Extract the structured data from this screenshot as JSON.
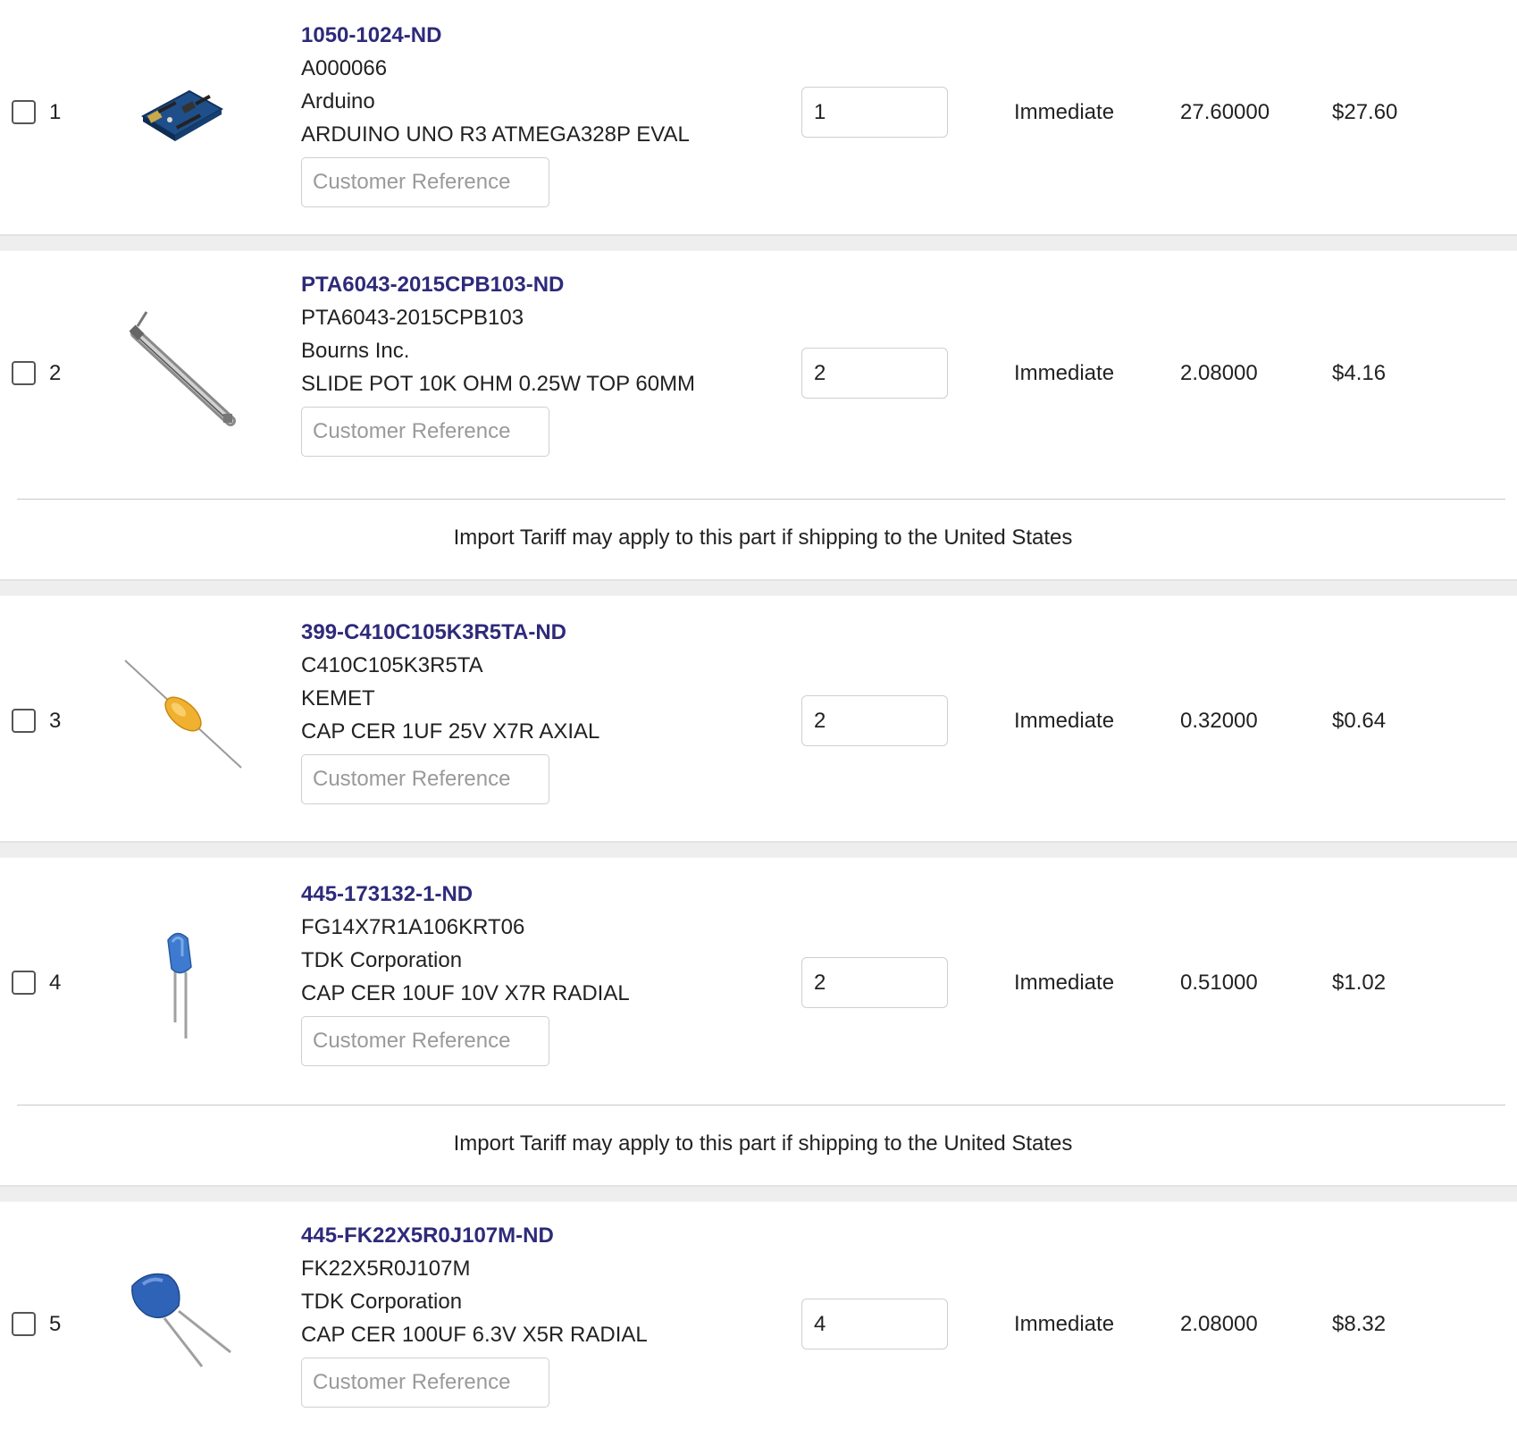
{
  "customer_reference_placeholder": "Customer Reference",
  "items": [
    {
      "line": "1",
      "part_number": "1050-1024-ND",
      "mfr_part": "A000066",
      "manufacturer": "Arduino",
      "description": "ARDUINO UNO R3 ATMEGA328P EVAL",
      "quantity": "1",
      "availability": "Immediate",
      "unit_price": "27.60000",
      "extended_price": "$27.60",
      "image_icon": "arduino-board-icon"
    },
    {
      "line": "2",
      "part_number": "PTA6043-2015CPB103-ND",
      "mfr_part": "PTA6043-2015CPB103",
      "manufacturer": "Bourns Inc.",
      "description": "SLIDE POT 10K OHM 0.25W TOP 60MM",
      "quantity": "2",
      "availability": "Immediate",
      "unit_price": "2.08000",
      "extended_price": "$4.16",
      "image_icon": "slide-potentiometer-icon",
      "tariff_notice": "Import Tariff may apply to this part if shipping to the United States"
    },
    {
      "line": "3",
      "part_number": "399-C410C105K3R5TA-ND",
      "mfr_part": "C410C105K3R5TA",
      "manufacturer": "KEMET",
      "description": "CAP CER 1UF 25V X7R AXIAL",
      "quantity": "2",
      "availability": "Immediate",
      "unit_price": "0.32000",
      "extended_price": "$0.64",
      "image_icon": "axial-capacitor-icon"
    },
    {
      "line": "4",
      "part_number": "445-173132-1-ND",
      "mfr_part": "FG14X7R1A106KRT06",
      "manufacturer": "TDK Corporation",
      "description": "CAP CER 10UF 10V X7R RADIAL",
      "quantity": "2",
      "availability": "Immediate",
      "unit_price": "0.51000",
      "extended_price": "$1.02",
      "image_icon": "radial-capacitor-icon",
      "tariff_notice": "Import Tariff may apply to this part if shipping to the United States"
    },
    {
      "line": "5",
      "part_number": "445-FK22X5R0J107M-ND",
      "mfr_part": "FK22X5R0J107M",
      "manufacturer": "TDK Corporation",
      "description": "CAP CER 100UF 6.3V X5R RADIAL",
      "quantity": "4",
      "availability": "Immediate",
      "unit_price": "2.08000",
      "extended_price": "$8.32",
      "image_icon": "radial-capacitor-large-icon"
    }
  ],
  "colors": {
    "part_link": "#2e2a7a",
    "separator": "#eeeeee",
    "input_border": "#cfcfcf",
    "placeholder": "#9a9a9a"
  }
}
